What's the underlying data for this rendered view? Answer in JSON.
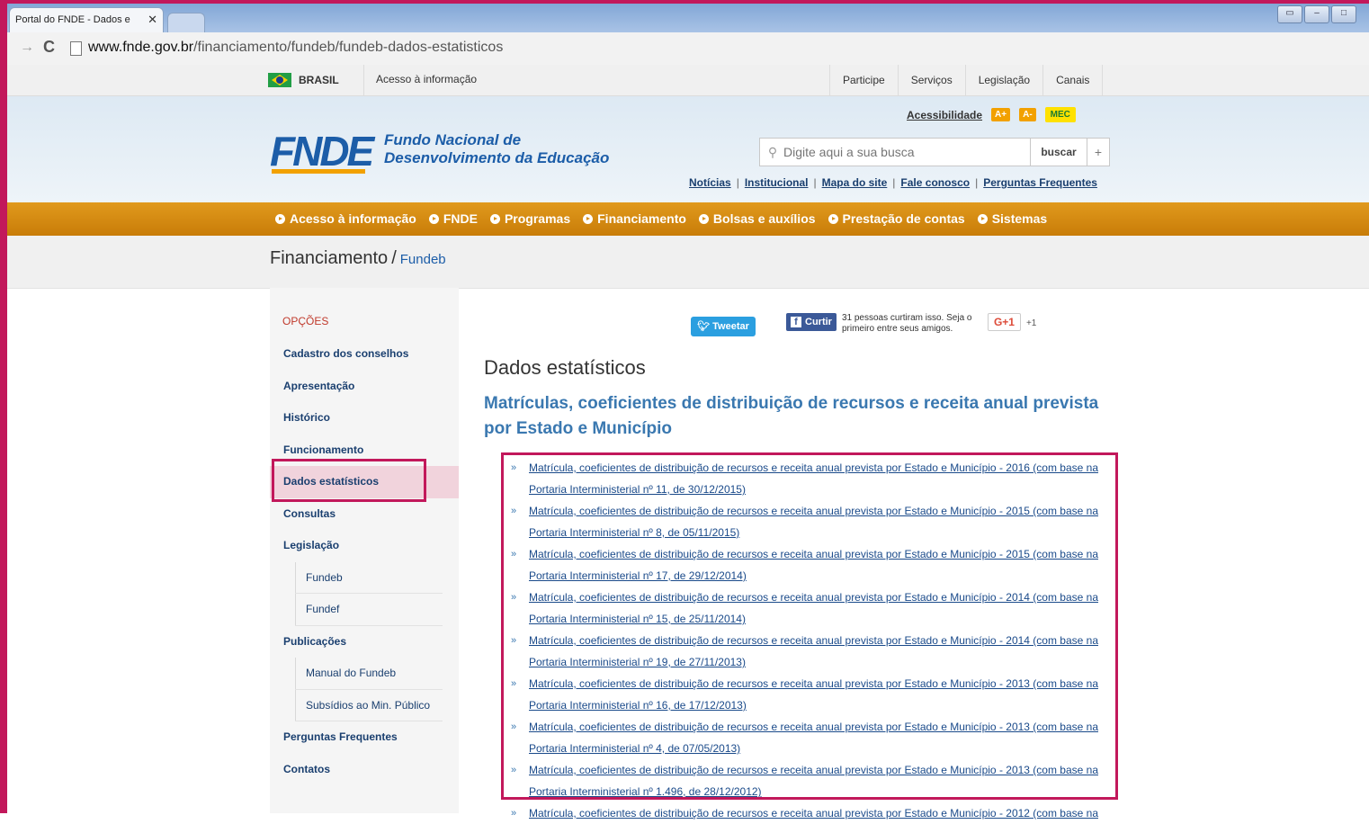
{
  "browser": {
    "tab_title": "Portal do FNDE - Dados e",
    "tab_close": "✕",
    "url_host": "www.fnde.gov.br",
    "url_path": "/financiamento/fundeb/fundeb-dados-estatisticos"
  },
  "govbar": {
    "brasil": "BRASIL",
    "acesso": "Acesso à informação",
    "links": [
      "Participe",
      "Serviços",
      "Legislação",
      "Canais"
    ]
  },
  "header": {
    "logo": "FNDE",
    "logo_line1": "Fundo Nacional de",
    "logo_line2": "Desenvolvimento da Educação",
    "acessibilidade": "Acessibilidade",
    "font_increase": "A+",
    "font_decrease": "A-",
    "mec": "MEC",
    "search_placeholder": "Digite aqui a sua busca",
    "search_button": "buscar",
    "search_plus": "+",
    "quick_links": [
      "Notícias",
      "Institucional",
      "Mapa do site",
      "Fale conosco",
      "Perguntas Frequentes"
    ]
  },
  "mainnav": [
    "Acesso à informação",
    "FNDE",
    "Programas",
    "Financiamento",
    "Bolsas e auxílios",
    "Prestação de contas",
    "Sistemas"
  ],
  "breadcrumb": {
    "section": "Financiamento",
    "separator": "/",
    "current": "Fundeb"
  },
  "sidebar": {
    "title": "OPÇÕES",
    "items": [
      {
        "label": "Cadastro dos conselhos",
        "type": "main"
      },
      {
        "label": "Apresentação",
        "type": "main"
      },
      {
        "label": "Histórico",
        "type": "main"
      },
      {
        "label": "Funcionamento",
        "type": "main"
      },
      {
        "label": "Dados estatísticos",
        "type": "main",
        "active": true
      },
      {
        "label": "Consultas",
        "type": "main"
      },
      {
        "label": "Legislação",
        "type": "main"
      },
      {
        "label": "Fundeb",
        "type": "sub"
      },
      {
        "label": "Fundef",
        "type": "sub"
      },
      {
        "label": "Publicações",
        "type": "main"
      },
      {
        "label": "Manual do Fundeb",
        "type": "sub"
      },
      {
        "label": "Subsídios ao Min. Público",
        "type": "sub"
      },
      {
        "label": "Perguntas Frequentes",
        "type": "main"
      },
      {
        "label": "Contatos",
        "type": "main"
      }
    ]
  },
  "social": {
    "tweet": "Tweetar",
    "fb_like": "Curtir",
    "fb_text": "31 pessoas curtiram isso. Seja o primeiro entre seus amigos.",
    "gplus": "G+1",
    "gplus_count": "+1"
  },
  "content": {
    "title": "Dados estatísticos",
    "subtitle": "Matrículas, coeficientes de distribuição de recursos e receita anual prevista por Estado e Município",
    "links": [
      "Matrícula, coeficientes de distribuição de recursos e receita anual prevista por Estado e Município - 2016 (com base na Portaria Interministerial nº 11, de 30/12/2015)",
      "Matrícula, coeficientes de distribuição de recursos e receita anual prevista por Estado e Município - 2015 (com base na Portaria Interministerial nº 8, de 05/11/2015)",
      "Matrícula, coeficientes de distribuição de recursos e receita anual prevista por Estado e Município - 2015 (com base na Portaria Interministerial nº 17, de 29/12/2014)",
      "Matrícula, coeficientes de distribuição de recursos e receita anual prevista por Estado e Município - 2014 (com base na Portaria Interministerial nº 15, de 25/11/2014)",
      "Matrícula, coeficientes de distribuição de recursos e receita anual prevista por Estado e Município - 2014 (com base na Portaria Interministerial nº 19, de 27/11/2013)",
      "Matrícula, coeficientes de distribuição de recursos e receita anual prevista por Estado e Município - 2013 (com base na Portaria Interministerial nº 16, de 17/12/2013)",
      "Matrícula, coeficientes de distribuição de recursos e receita anual prevista por Estado e Município - 2013 (com base na Portaria Interministerial nº 4, de 07/05/2013)",
      "Matrícula, coeficientes de distribuição de recursos e receita anual prevista por Estado e Município - 2013 (com base na Portaria Interministerial nº 1.496, de 28/12/2012)",
      "Matrícula, coeficientes de distribuição de recursos e receita anual prevista por Estado e Município - 2012 (com base na"
    ]
  },
  "colors": {
    "highlight": "#c2185b",
    "nav_orange": "#d98f13",
    "brand_blue": "#1c5da8"
  }
}
